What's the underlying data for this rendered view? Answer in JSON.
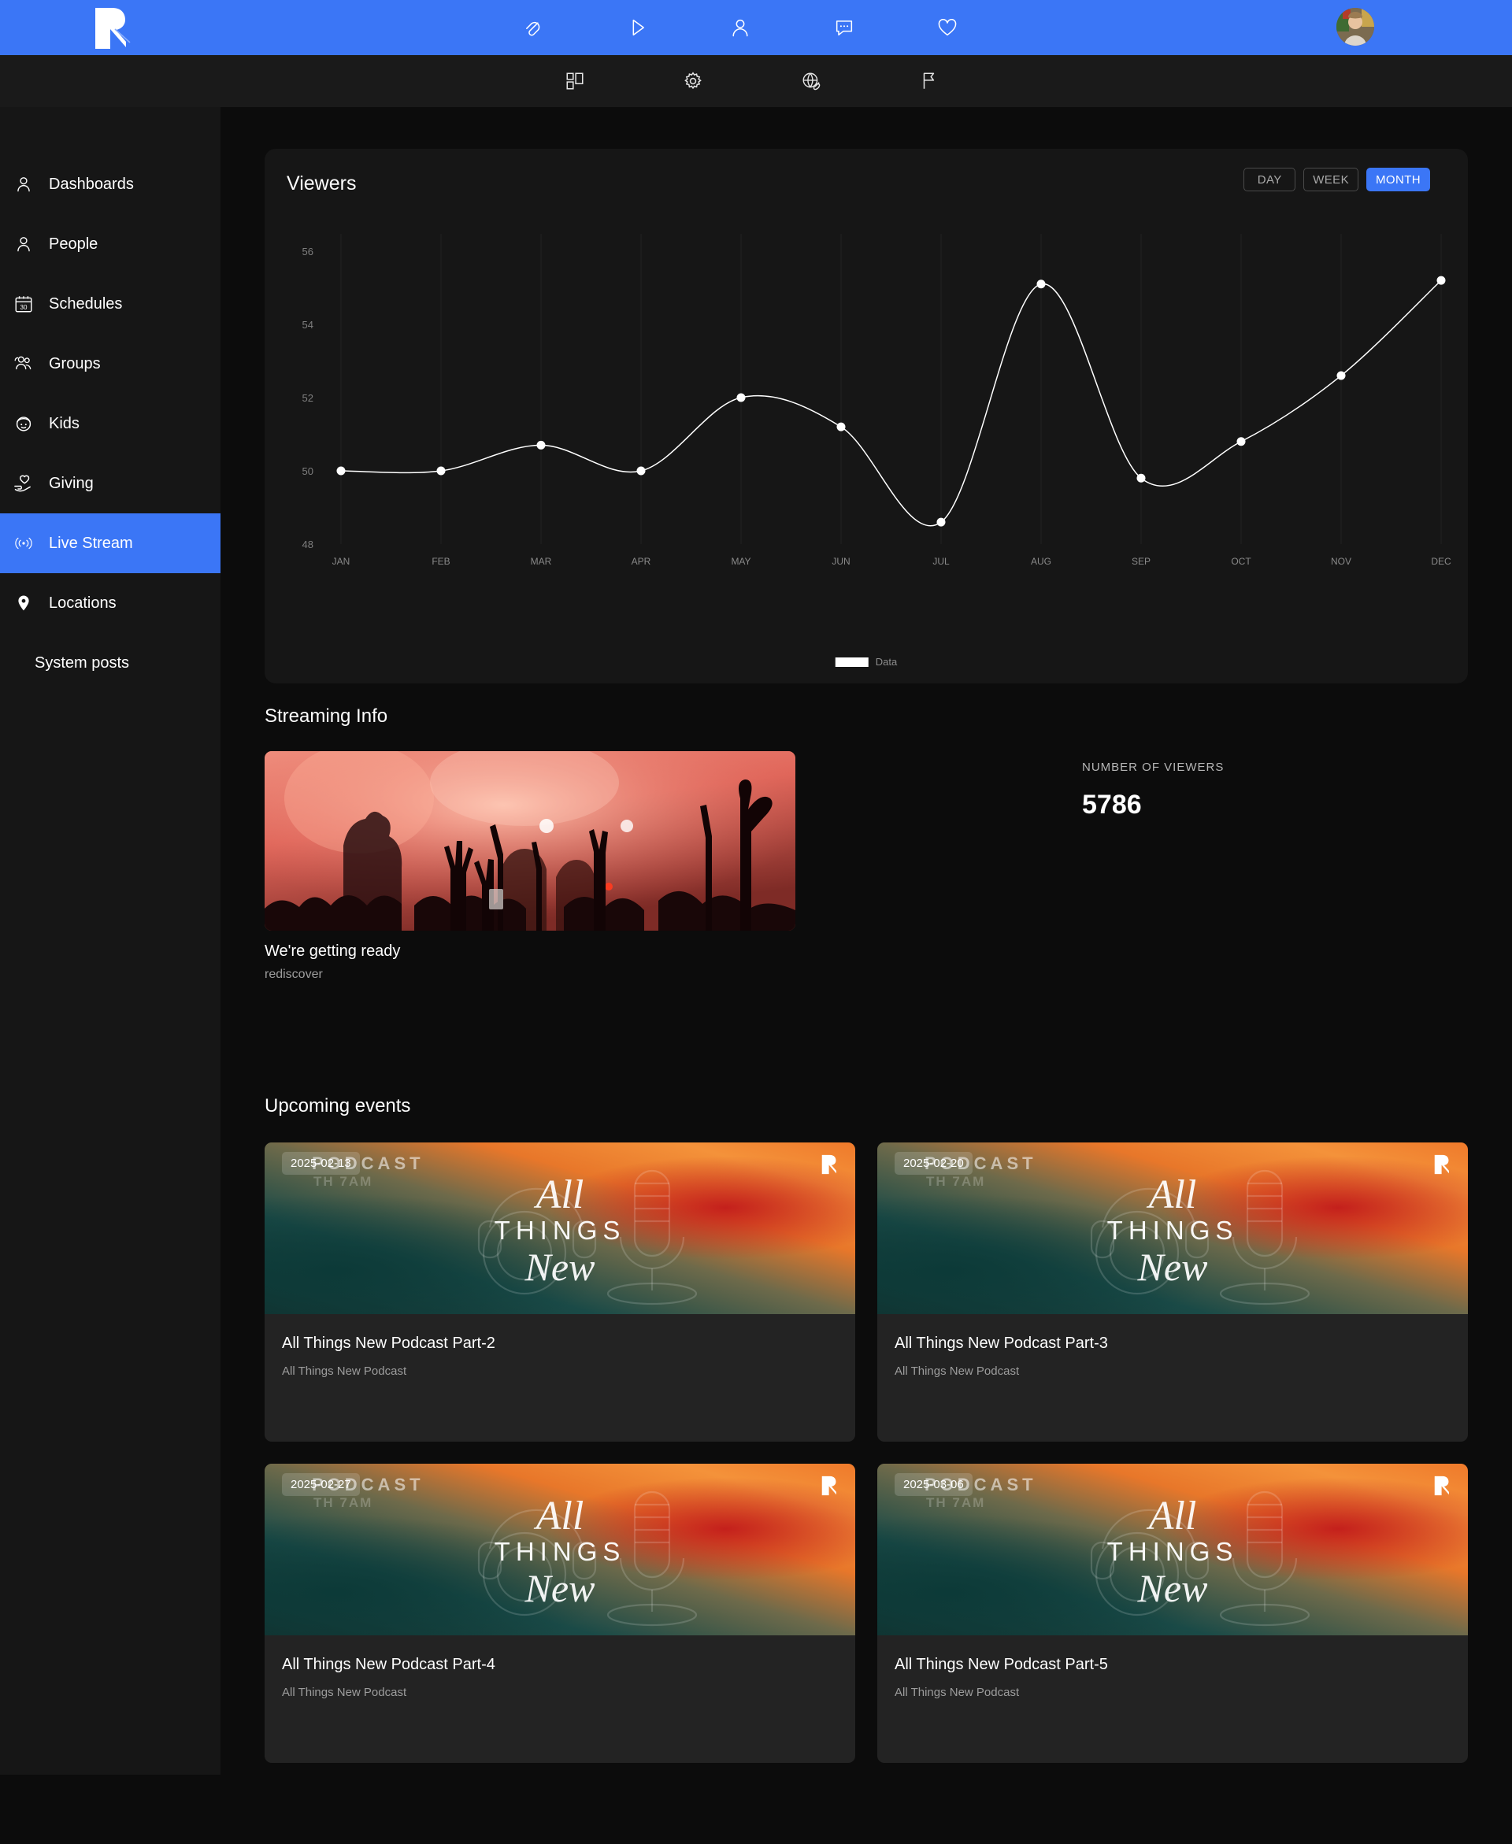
{
  "topbar": {
    "logo_name": "rock-logo",
    "icons": [
      {
        "name": "paperclip-icon",
        "label": "Attachments"
      },
      {
        "name": "play-icon",
        "label": "Media"
      },
      {
        "name": "person-icon",
        "label": "Profile"
      },
      {
        "name": "chat-bubble-icon",
        "label": "Messages"
      },
      {
        "name": "heart-icon",
        "label": "Favorites"
      }
    ],
    "avatar_label": "User avatar"
  },
  "subnav": {
    "icons": [
      {
        "name": "dashboard-grid-icon",
        "label": "Dashboard"
      },
      {
        "name": "gear-icon",
        "label": "Settings"
      },
      {
        "name": "globe-link-icon",
        "label": "Web"
      },
      {
        "name": "flag-icon",
        "label": "Flag"
      }
    ]
  },
  "sidebar": {
    "items": [
      {
        "label": "Dashboards",
        "icon": "person-icon",
        "active": false
      },
      {
        "label": "People",
        "icon": "person-icon",
        "active": false
      },
      {
        "label": "Schedules",
        "icon": "calendar-30-icon",
        "active": false
      },
      {
        "label": "Groups",
        "icon": "people-group-icon",
        "active": false
      },
      {
        "label": "Kids",
        "icon": "kid-face-icon",
        "active": false
      },
      {
        "label": "Giving",
        "icon": "hand-heart-icon",
        "active": false
      },
      {
        "label": "Live Stream",
        "icon": "broadcast-icon",
        "active": true
      },
      {
        "label": "Locations",
        "icon": "map-pin-icon",
        "active": false
      },
      {
        "label": "System posts",
        "icon": "none",
        "active": false
      }
    ]
  },
  "chart_card": {
    "title": "Viewers",
    "ranges": [
      {
        "label": "DAY",
        "active": false
      },
      {
        "label": "WEEK",
        "active": false
      },
      {
        "label": "MONTH",
        "active": true
      }
    ]
  },
  "chart_data": {
    "type": "line",
    "title": "Viewers",
    "xlabel": "",
    "ylabel": "",
    "categories": [
      "JAN",
      "FEB",
      "MAR",
      "APR",
      "MAY",
      "JUN",
      "JUL",
      "AUG",
      "SEP",
      "OCT",
      "NOV",
      "DEC"
    ],
    "series": [
      {
        "name": "Data",
        "values": [
          50,
          50,
          50.7,
          50,
          52,
          51.2,
          48.6,
          55.1,
          49.8,
          50.8,
          52.6,
          55.2
        ]
      }
    ],
    "ylim": [
      48,
      56.6
    ],
    "yticks": [
      48,
      50,
      52,
      54,
      56
    ],
    "ytick_labels": [
      "48",
      "50",
      "52",
      "54",
      "56"
    ],
    "grid": true,
    "legend": {
      "position": "bottom-center",
      "entries": [
        "Data"
      ],
      "swatch_color": "#ffffff"
    },
    "line_color": "#ffffff",
    "marker_color": "#ffffff"
  },
  "streaming": {
    "section_title": "Streaming Info",
    "thumb_name": "concert-crowd-thumbnail",
    "title": "We're getting ready",
    "subtitle": "rediscover",
    "viewers_label": "NUMBER OF VIEWERS",
    "viewers_count": "5786"
  },
  "events": {
    "section_title": "Upcoming events",
    "banner_ghost_text": "PODCAST",
    "banner_ghost_time": "TH 7AM",
    "banner_art_lines": {
      "line1": "All",
      "line2": "THINGS",
      "line3": "New"
    },
    "items": [
      {
        "date": "2025-02-13",
        "title": "All Things New Podcast Part-2",
        "subtitle": "All Things New Podcast"
      },
      {
        "date": "2025-02-20",
        "title": "All Things New Podcast Part-3",
        "subtitle": "All Things New Podcast"
      },
      {
        "date": "2025-02-27",
        "title": "All Things New Podcast Part-4",
        "subtitle": "All Things New Podcast"
      },
      {
        "date": "2025-03-06",
        "title": "All Things New Podcast Part-5",
        "subtitle": "All Things New Podcast"
      }
    ]
  },
  "colors": {
    "brand_blue": "#3b76f6",
    "page_bg": "#0c0c0c",
    "panel_bg": "#161616",
    "card_bg": "#232323"
  }
}
